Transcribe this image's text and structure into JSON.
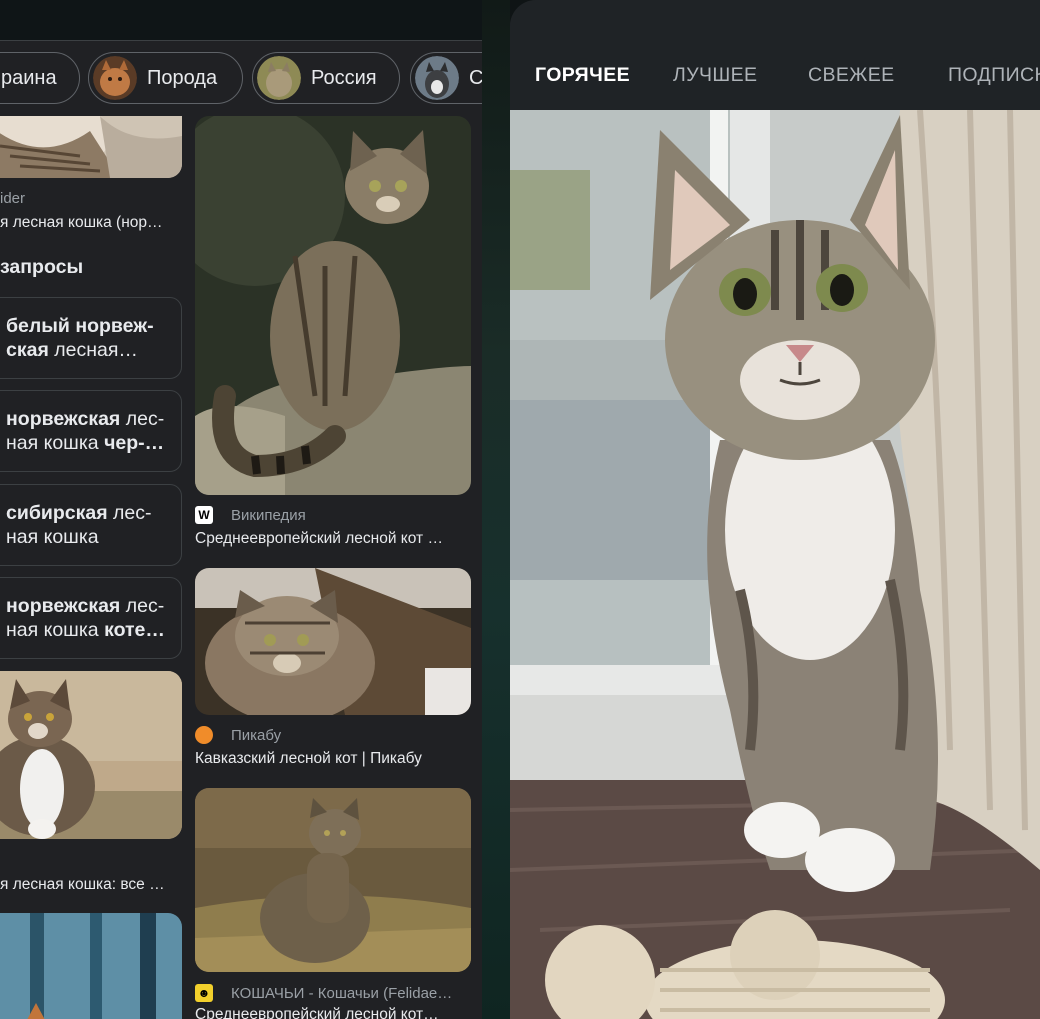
{
  "chips": [
    {
      "label": "раина",
      "thumb": "none"
    },
    {
      "label": "Порода",
      "thumb": "cat-thumb"
    },
    {
      "label": "Россия",
      "thumb": "cat-thumb"
    },
    {
      "label": "С",
      "thumb": "cat-thumb"
    }
  ],
  "left_col": {
    "top_source": "ider",
    "top_title": "я лесная кошка (нор…",
    "related_heading": "запросы",
    "related": [
      {
        "bold1": "белый норвеж-",
        "bold2": "ская",
        "rest2": " лесная…"
      },
      {
        "bold1": "норвежская",
        "rest1": " лес-",
        "rest2": "ная кошка ",
        "bold2": "чер-…"
      },
      {
        "bold1": "сибирская",
        "rest1": " лес-",
        "rest2": "ная кошка"
      },
      {
        "bold1": "норвежская",
        "rest1": " лес-",
        "rest2": "ная кошка ",
        "bold2": "коте…"
      }
    ],
    "bottom_title": "я лесная кошка: все …"
  },
  "right_col": [
    {
      "source": "Википедия",
      "favicon": "wikipedia-icon",
      "title": "Среднеевропейский лесной кот …"
    },
    {
      "source": "Пикабу",
      "favicon": "pikabu-icon",
      "title": "Кавказский лесной кот | Пикабу"
    },
    {
      "source": "КОШАЧЬИ - Кошачьи (Felidae…",
      "favicon": "koshachi-icon",
      "title": "Среднеевропейский лесной кот…"
    }
  ],
  "feed_tabs": [
    "ГОРЯЧЕЕ",
    "ЛУЧШЕЕ",
    "СВЕЖЕЕ",
    "ПОДПИСКИ"
  ],
  "colors": {
    "bg": "#202124",
    "chip_border": "#5f6368",
    "feed_bg": "#1f2326"
  }
}
